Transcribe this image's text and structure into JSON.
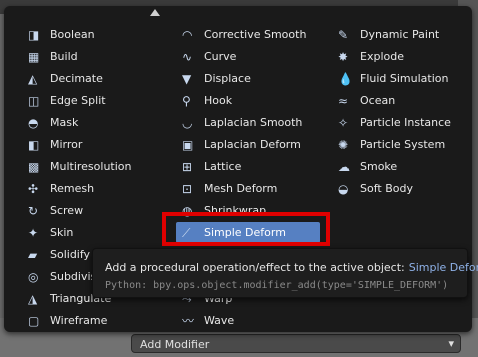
{
  "header": {
    "add_modifier_label": "Add Modifier"
  },
  "menu": {
    "columns": [
      [
        {
          "label": "Boolean",
          "icon": "boolean-icon"
        },
        {
          "label": "Build",
          "icon": "build-icon"
        },
        {
          "label": "Decimate",
          "icon": "decimate-icon"
        },
        {
          "label": "Edge Split",
          "icon": "edge-split-icon"
        },
        {
          "label": "Mask",
          "icon": "mask-icon"
        },
        {
          "label": "Mirror",
          "icon": "mirror-icon"
        },
        {
          "label": "Multiresolution",
          "icon": "multiresolution-icon"
        },
        {
          "label": "Remesh",
          "icon": "remesh-icon"
        },
        {
          "label": "Screw",
          "icon": "screw-icon"
        },
        {
          "label": "Skin",
          "icon": "skin-icon"
        },
        {
          "label": "Solidify",
          "icon": "solidify-icon"
        },
        {
          "label": "Subdivision Surface",
          "icon": "subdivision-icon"
        },
        {
          "label": "Triangulate",
          "icon": "triangulate-icon"
        },
        {
          "label": "Wireframe",
          "icon": "wireframe-icon"
        }
      ],
      [
        {
          "label": "Corrective Smooth",
          "icon": "corrective-smooth-icon"
        },
        {
          "label": "Curve",
          "icon": "curve-icon"
        },
        {
          "label": "Displace",
          "icon": "displace-icon"
        },
        {
          "label": "Hook",
          "icon": "hook-icon"
        },
        {
          "label": "Laplacian Smooth",
          "icon": "laplacian-smooth-icon"
        },
        {
          "label": "Laplacian Deform",
          "icon": "laplacian-deform-icon"
        },
        {
          "label": "Lattice",
          "icon": "lattice-icon"
        },
        {
          "label": "Mesh Deform",
          "icon": "mesh-deform-icon"
        },
        {
          "label": "Shrinkwrap",
          "icon": "shrinkwrap-icon"
        },
        {
          "label": "Simple Deform",
          "icon": "simple-deform-icon",
          "highlighted": true
        },
        {
          "label": "",
          "icon": ""
        },
        {
          "label": "",
          "icon": ""
        },
        {
          "label": "Warp",
          "icon": "warp-icon"
        },
        {
          "label": "Wave",
          "icon": "wave-icon"
        }
      ],
      [
        {
          "label": "Dynamic Paint",
          "icon": "dynamic-paint-icon"
        },
        {
          "label": "Explode",
          "icon": "explode-icon"
        },
        {
          "label": "Fluid Simulation",
          "icon": "fluid-icon"
        },
        {
          "label": "Ocean",
          "icon": "ocean-icon"
        },
        {
          "label": "Particle Instance",
          "icon": "particle-instance-icon"
        },
        {
          "label": "Particle System",
          "icon": "particle-system-icon"
        },
        {
          "label": "Smoke",
          "icon": "smoke-icon"
        },
        {
          "label": "Soft Body",
          "icon": "soft-body-icon"
        }
      ]
    ]
  },
  "tooltip": {
    "description": "Add a procedural operation/effect to the active object:",
    "name": "Simple Deform",
    "python": "Python: bpy.ops.object.modifier_add(type='SIMPLE_DEFORM')"
  },
  "colors": {
    "highlight": "#5680c2",
    "menu_bg": "#1a1a1a",
    "callout": "#e00000"
  }
}
